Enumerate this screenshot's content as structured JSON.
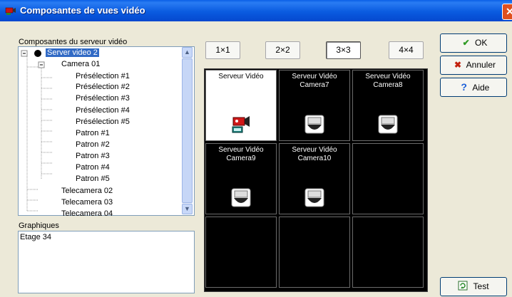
{
  "window": {
    "title": "Composantes de vues vidéo",
    "close_glyph": "✕"
  },
  "tree": {
    "label": "Composantes du serveur vidéo",
    "rows": [
      {
        "label": "Server video 2",
        "selected": true
      },
      {
        "label": "Camera 01"
      },
      {
        "label": "Présélection #1"
      },
      {
        "label": "Présélection #2"
      },
      {
        "label": "Présélection #3"
      },
      {
        "label": "Présélection #4"
      },
      {
        "label": "Présélection #5"
      },
      {
        "label": "Patron #1"
      },
      {
        "label": "Patron #2"
      },
      {
        "label": "Patron #3"
      },
      {
        "label": "Patron #4"
      },
      {
        "label": "Patron #5"
      },
      {
        "label": "Telecamera 02"
      },
      {
        "label": "Telecamera 03"
      },
      {
        "label": "Telecamera 04"
      }
    ],
    "expander_minus": "−"
  },
  "graphics": {
    "label": "Graphiques",
    "items": [
      "Etage 34"
    ]
  },
  "layouts": [
    "1×1",
    "2×2",
    "3×3",
    "4×4"
  ],
  "active_layout": "3×3",
  "cells": [
    {
      "line1": "Serveur Vidéo",
      "line2": "",
      "icon": "camera-red-icon"
    },
    {
      "line1": "Serveur Vidéo",
      "line2": "Camera7",
      "icon": "dome-camera-icon"
    },
    {
      "line1": "Serveur Vidéo",
      "line2": "Camera8",
      "icon": "dome-camera-icon"
    },
    {
      "line1": "Serveur Vidéo",
      "line2": "Camera9",
      "icon": "dome-camera-icon"
    },
    {
      "line1": "Serveur Vidéo",
      "line2": "Camera10",
      "icon": "dome-camera-icon"
    },
    {
      "line1": "",
      "line2": "",
      "icon": ""
    },
    {
      "line1": "",
      "line2": "",
      "icon": ""
    },
    {
      "line1": "",
      "line2": "",
      "icon": ""
    },
    {
      "line1": "",
      "line2": "",
      "icon": ""
    }
  ],
  "buttons": {
    "ok": "OK",
    "cancel": "Annuler",
    "help": "Aide",
    "test": "Test",
    "ok_glyph": "✔",
    "cancel_glyph": "✖",
    "help_glyph": "?"
  },
  "colors": {
    "titlebar": "#0a5be0",
    "selection": "#316ac5",
    "ok_green": "#2e9a23",
    "cancel_red": "#c2210e",
    "help_blue": "#1b5fd8"
  }
}
